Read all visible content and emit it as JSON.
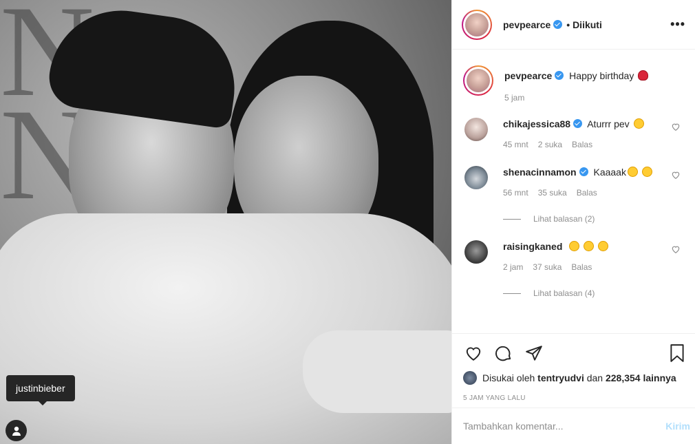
{
  "post": {
    "photo_tag": "justinbieber"
  },
  "header": {
    "username": "pevpearce",
    "follow_status": "• Diikuti",
    "more": "•••"
  },
  "caption": {
    "username": "pevpearce",
    "text": "Happy birthday",
    "time": "5 jam"
  },
  "comments": [
    {
      "username": "chikajessica88",
      "verified": true,
      "text": "Aturrr pev",
      "time": "45 mnt",
      "likes": "2 suka",
      "reply": "Balas",
      "emojis": [
        "laughing"
      ]
    },
    {
      "username": "shenacinnamon",
      "verified": true,
      "text": "Kaaaak",
      "time": "56 mnt",
      "likes": "35 suka",
      "reply": "Balas",
      "emojis": [
        "rofl",
        "rofl"
      ],
      "view_replies": "Lihat balasan (2)"
    },
    {
      "username": "raisingkaned",
      "verified": false,
      "text": "",
      "time": "2 jam",
      "likes": "37 suka",
      "reply": "Balas",
      "emojis": [
        "grin",
        "laughing",
        "wink"
      ],
      "view_replies": "Lihat balasan (4)"
    }
  ],
  "likes": {
    "prefix": "Disukai oleh",
    "user": "tentryudvi",
    "and": "dan",
    "count": "228,354 lainnya"
  },
  "timestamp": "5 JAM YANG LALU",
  "add_comment": {
    "placeholder": "Tambahkan komentar...",
    "post_label": "Kirim"
  },
  "colors": {
    "verified": "#3897f0",
    "post_disabled": "#b2dffc",
    "muted": "#8e8e8e"
  }
}
